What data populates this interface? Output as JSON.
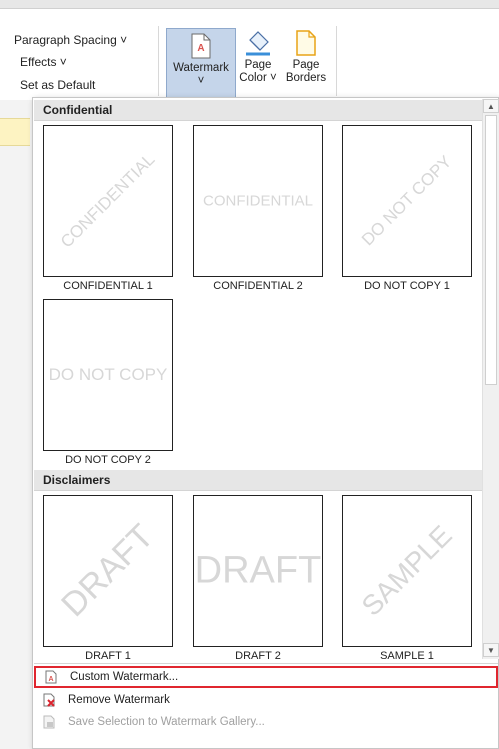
{
  "ribbon": {
    "paragraph_spacing": "Paragraph Spacing ˅",
    "effects": "Effects ˅",
    "set_as_default": "Set as Default",
    "watermark_label": "Watermark",
    "watermark_chevron": "˅",
    "page_color_line1": "Page",
    "page_color_line2": "Color ˅",
    "page_borders_line1": "Page",
    "page_borders_line2": "Borders"
  },
  "gallery": {
    "sections": [
      {
        "header": "Confidential",
        "items": [
          {
            "label": "CONFIDENTIAL 1",
            "watermark": "CONFIDENTIAL",
            "style": "diagonal"
          },
          {
            "label": "CONFIDENTIAL 2",
            "watermark": "CONFIDENTIAL",
            "style": "horizontal"
          },
          {
            "label": "DO NOT COPY 1",
            "watermark": "DO NOT COPY",
            "style": "diagonal"
          },
          {
            "label": "DO NOT COPY 2",
            "watermark": "DO NOT COPY",
            "style": "horizontal"
          }
        ]
      },
      {
        "header": "Disclaimers",
        "items": [
          {
            "label": "DRAFT 1",
            "watermark": "DRAFT",
            "style": "diagonal"
          },
          {
            "label": "DRAFT 2",
            "watermark": "DRAFT",
            "style": "horizontal"
          },
          {
            "label": "SAMPLE 1",
            "watermark": "SAMPLE",
            "style": "diagonal"
          }
        ]
      }
    ]
  },
  "menu": {
    "custom_watermark": "Custom Watermark...",
    "remove_watermark": "Remove Watermark",
    "save_selection": "Save Selection to Watermark Gallery..."
  },
  "colors": {
    "highlight_border": "#e0262f",
    "watermark_button_bg": "#c5d5ea",
    "section_header_bg": "#e6e6e6"
  }
}
